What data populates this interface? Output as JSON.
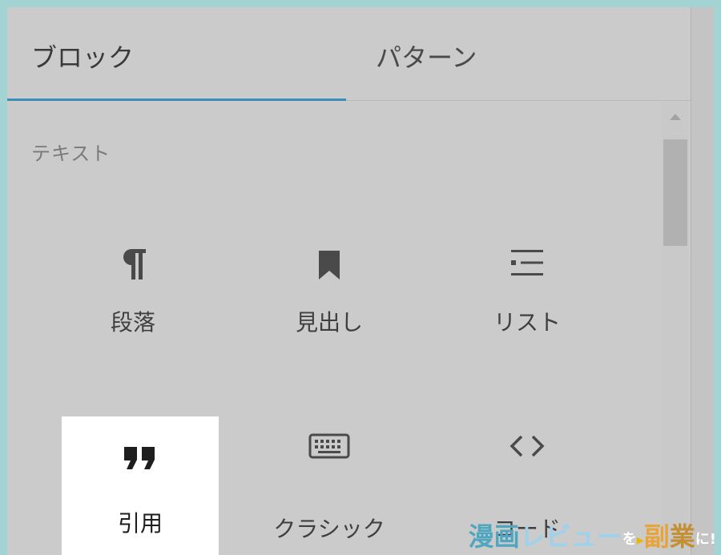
{
  "tabs": [
    {
      "label": "ブロック",
      "active": true
    },
    {
      "label": "パターン",
      "active": false
    }
  ],
  "section": {
    "title": "テキスト"
  },
  "blocks": [
    {
      "label": "段落",
      "icon": "paragraph-icon"
    },
    {
      "label": "見出し",
      "icon": "bookmark-icon"
    },
    {
      "label": "リスト",
      "icon": "list-icon"
    },
    {
      "label": "引用",
      "icon": "quote-icon",
      "selected": true
    },
    {
      "label": "クラシック",
      "icon": "keyboard-icon"
    },
    {
      "label": "コード",
      "icon": "code-icon"
    }
  ],
  "watermark": {
    "part1": "漫画",
    "part2": "レビュー",
    "part3": "を",
    "part4": "▸",
    "part5": "副",
    "part6": "業",
    "part7": "に!"
  },
  "colors": {
    "accent": "#3c8db8",
    "panel": "#cbcbcb",
    "frame": "#a3d3d3",
    "selected": "#ffffff"
  }
}
